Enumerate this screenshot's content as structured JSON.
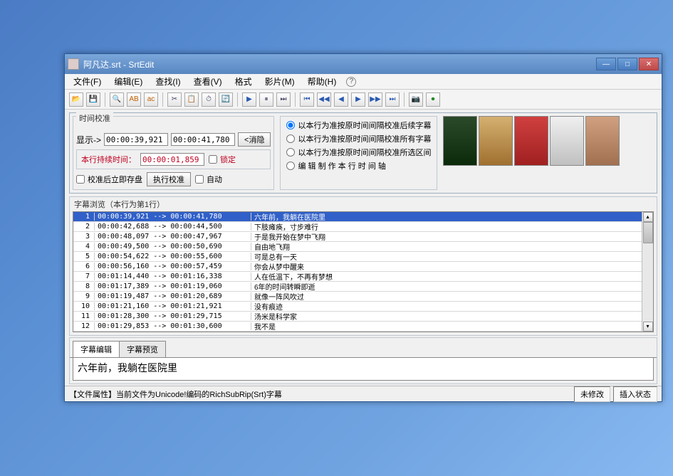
{
  "title": "阿凡达.srt - SrtEdit",
  "menu": [
    "文件(F)",
    "编辑(E)",
    "查找(I)",
    "查看(V)",
    "格式",
    "影片(M)",
    "帮助(H)"
  ],
  "time_cal": {
    "legend": "时间校准",
    "show_label": "显示->",
    "start": "00:00:39,921",
    "end": "00:00:41,780",
    "elim_btn": "<消隐",
    "dur_label": "本行持续时间：",
    "duration": "00:00:01,859",
    "lock_chk": "锁定",
    "save_chk": "校准后立即存盘",
    "calib_btn": "执行校准",
    "auto_chk": "自动"
  },
  "radios": [
    "以本行为准按原时间间隔校准后续字幕",
    "以本行为准按原时间间隔校准所有字幕",
    "以本行为准按原时间间隔校准所选区间",
    "编 辑 制 作 本 行 时 间 轴"
  ],
  "list_legend": "字幕浏览（本行为第1行）",
  "rows": [
    {
      "i": 1,
      "tc": "00:00:39,921 --> 00:00:41,780",
      "txt": "六年前，我躺在医院里"
    },
    {
      "i": 2,
      "tc": "00:00:42,688 --> 00:00:44,500",
      "txt": "下肢瘫痪，寸步难行"
    },
    {
      "i": 3,
      "tc": "00:00:48,097 --> 00:00:47,967",
      "txt": "于是我开始在梦中飞翔"
    },
    {
      "i": 4,
      "tc": "00:00:49,500 --> 00:00:50,690",
      "txt": "自由地飞翔"
    },
    {
      "i": 5,
      "tc": "00:00:54,622 --> 00:00:55,600",
      "txt": "可是总有一天"
    },
    {
      "i": 6,
      "tc": "00:00:56,160 --> 00:00:57,459",
      "txt": "你会从梦中醒来"
    },
    {
      "i": 7,
      "tc": "00:01:14,440 --> 00:01:16,338",
      "txt": "人在低温下，不再有梦想"
    },
    {
      "i": 8,
      "tc": "00:01:17,389 --> 00:01:19,060",
      "txt": "6年的时间转瞬即逝"
    },
    {
      "i": 9,
      "tc": "00:01:19,487 --> 00:01:20,689",
      "txt": "就像一阵风吹过"
    },
    {
      "i": 10,
      "tc": "00:01:21,160 --> 00:01:21,921",
      "txt": "没有痕迹"
    },
    {
      "i": 11,
      "tc": "00:01:28,300 --> 00:01:29,715",
      "txt": "汤米是科学家"
    },
    {
      "i": 12,
      "tc": "00:01:29,853 --> 00:01:30,600",
      "txt": "我不是"
    }
  ],
  "tabs": {
    "edit": "字幕编辑",
    "preview": "字幕预览"
  },
  "editor_text": "六年前，我躺在医院里",
  "status": {
    "main": "【文件属性】当前文件为Unicode!编码的RichSubRip(Srt)字幕",
    "mod": "未修改",
    "ins": "插入状态"
  }
}
